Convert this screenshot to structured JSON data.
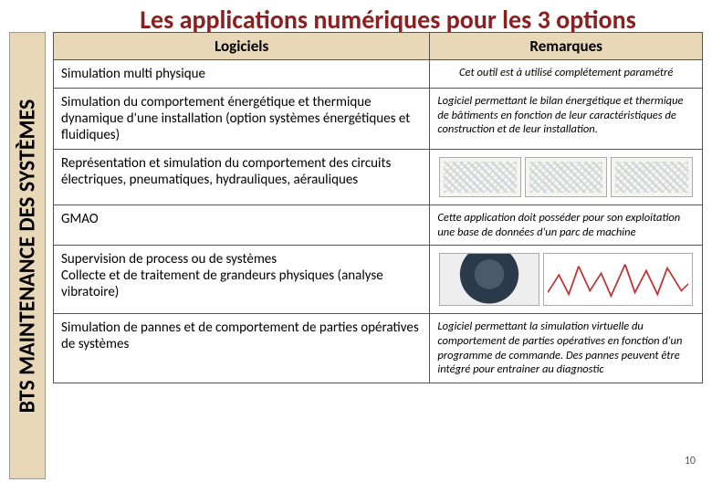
{
  "title": "Les applications numériques pour les 3 options",
  "sidebar_label": "BTS MAINTENANCE DES SYSTÈMES",
  "headers": {
    "col1": "Logiciels",
    "col2": "Remarques"
  },
  "rows": [
    {
      "software": "Simulation multi physique",
      "remark": "Cet outil est à utilisé complétement paramétré"
    },
    {
      "software": "Simulation du comportement énergétique et thermique dynamique d'une installation (option systèmes énergétiques et fluidiques)",
      "remark": "Logiciel permettant le bilan énergétique et thermique de bâtiments en fonction de leur caractéristiques de construction et de leur installation."
    },
    {
      "software": "Représentation et simulation du comportement des circuits électriques, pneumatiques, hydrauliques, aérauliques",
      "remark": ""
    },
    {
      "software": "GMAO",
      "remark": "Cette application doit posséder pour son exploitation une base de données d'un parc de machine"
    },
    {
      "software": "Supervision de process ou de systèmes\nCollecte et de traitement de grandeurs physiques (analyse vibratoire)",
      "remark": ""
    },
    {
      "software": "Simulation de pannes et de comportement de parties opératives de systèmes",
      "remark": "Logiciel permettant la simulation virtuelle du comportement de parties opératives en fonction d'un programme de commande. Des pannes peuvent être intégré pour entrainer au diagnostic"
    }
  ],
  "page_number": "10"
}
